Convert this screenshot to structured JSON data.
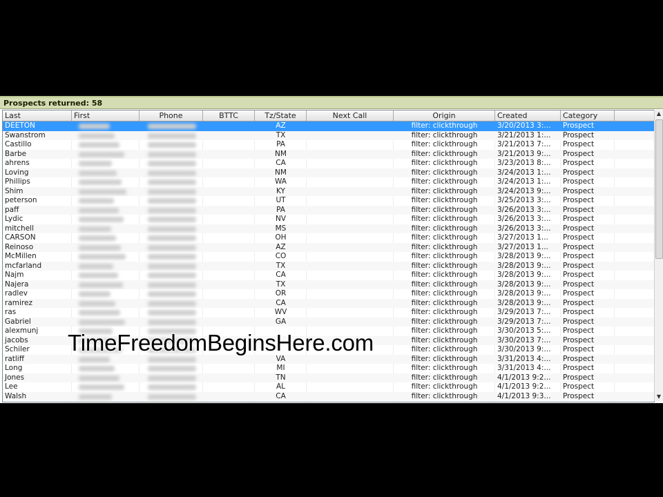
{
  "status": {
    "text": "Prospects returned: 58"
  },
  "columns": [
    "Last",
    "First",
    "Phone",
    "BTTC",
    "Tz/State",
    "Next Call",
    "Origin",
    "Created",
    "Category"
  ],
  "rows": [
    {
      "last": "DEETON",
      "first": "",
      "phone": "",
      "bttc": "",
      "state": "AZ",
      "next_call": "",
      "origin": "filter: clickthrough",
      "created": "3/20/2013 3:...",
      "category": "Prospect"
    },
    {
      "last": "Swanstrom",
      "first": "",
      "phone": "",
      "bttc": "",
      "state": "TX",
      "next_call": "",
      "origin": "filter: clickthrough",
      "created": "3/21/2013 1:...",
      "category": "Prospect"
    },
    {
      "last": "Castillo",
      "first": "",
      "phone": "",
      "bttc": "",
      "state": "PA",
      "next_call": "",
      "origin": "filter: clickthrough",
      "created": "3/21/2013 7:...",
      "category": "Prospect"
    },
    {
      "last": "Barbe",
      "first": "",
      "phone": "",
      "bttc": "",
      "state": "NM",
      "next_call": "",
      "origin": "filter: clickthrough",
      "created": "3/21/2013 9:...",
      "category": "Prospect"
    },
    {
      "last": "ahrens",
      "first": "",
      "phone": "",
      "bttc": "",
      "state": "CA",
      "next_call": "",
      "origin": "filter: clickthrough",
      "created": "3/23/2013 8:...",
      "category": "Prospect"
    },
    {
      "last": "Loving",
      "first": "",
      "phone": "",
      "bttc": "",
      "state": "NM",
      "next_call": "",
      "origin": "filter: clickthrough",
      "created": "3/24/2013 1:...",
      "category": "Prospect"
    },
    {
      "last": "Phillips",
      "first": "",
      "phone": "",
      "bttc": "",
      "state": "WA",
      "next_call": "",
      "origin": "filter: clickthrough",
      "created": "3/24/2013 1:...",
      "category": "Prospect"
    },
    {
      "last": "Shim",
      "first": "",
      "phone": "",
      "bttc": "",
      "state": "KY",
      "next_call": "",
      "origin": "filter: clickthrough",
      "created": "3/24/2013 9:...",
      "category": "Prospect"
    },
    {
      "last": "peterson",
      "first": "",
      "phone": "",
      "bttc": "",
      "state": "UT",
      "next_call": "",
      "origin": "filter: clickthrough",
      "created": "3/25/2013 3:...",
      "category": "Prospect"
    },
    {
      "last": "paff",
      "first": "",
      "phone": "",
      "bttc": "",
      "state": "PA",
      "next_call": "",
      "origin": "filter: clickthrough",
      "created": "3/26/2013 3:...",
      "category": "Prospect"
    },
    {
      "last": "Lydic",
      "first": "",
      "phone": "",
      "bttc": "",
      "state": "NV",
      "next_call": "",
      "origin": "filter: clickthrough",
      "created": "3/26/2013 3:...",
      "category": "Prospect"
    },
    {
      "last": "mitchell",
      "first": "",
      "phone": "",
      "bttc": "",
      "state": "MS",
      "next_call": "",
      "origin": "filter: clickthrough",
      "created": "3/26/2013 3:...",
      "category": "Prospect"
    },
    {
      "last": "CARSON",
      "first": "",
      "phone": "",
      "bttc": "",
      "state": "OH",
      "next_call": "",
      "origin": "filter: clickthrough",
      "created": "3/27/2013 1...",
      "category": "Prospect"
    },
    {
      "last": "Reinoso",
      "first": "",
      "phone": "",
      "bttc": "",
      "state": "AZ",
      "next_call": "",
      "origin": "filter: clickthrough",
      "created": "3/27/2013 1...",
      "category": "Prospect"
    },
    {
      "last": "McMillen",
      "first": "",
      "phone": "",
      "bttc": "",
      "state": "CO",
      "next_call": "",
      "origin": "filter: clickthrough",
      "created": "3/28/2013 9:...",
      "category": "Prospect"
    },
    {
      "last": "mcfarland",
      "first": "",
      "phone": "",
      "bttc": "",
      "state": "TX",
      "next_call": "",
      "origin": "filter: clickthrough",
      "created": "3/28/2013 9:...",
      "category": "Prospect"
    },
    {
      "last": "Najm",
      "first": "",
      "phone": "",
      "bttc": "",
      "state": "CA",
      "next_call": "",
      "origin": "filter: clickthrough",
      "created": "3/28/2013 9:...",
      "category": "Prospect"
    },
    {
      "last": "Najera",
      "first": "",
      "phone": "",
      "bttc": "",
      "state": "TX",
      "next_call": "",
      "origin": "filter: clickthrough",
      "created": "3/28/2013 9:...",
      "category": "Prospect"
    },
    {
      "last": "radlev",
      "first": "",
      "phone": "",
      "bttc": "",
      "state": "OR",
      "next_call": "",
      "origin": "filter: clickthrough",
      "created": "3/28/2013 9:...",
      "category": "Prospect"
    },
    {
      "last": "ramirez",
      "first": "",
      "phone": "",
      "bttc": "",
      "state": "CA",
      "next_call": "",
      "origin": "filter: clickthrough",
      "created": "3/28/2013 9:...",
      "category": "Prospect"
    },
    {
      "last": "ras",
      "first": "",
      "phone": "",
      "bttc": "",
      "state": "WV",
      "next_call": "",
      "origin": "filter: clickthrough",
      "created": "3/29/2013 7:...",
      "category": "Prospect"
    },
    {
      "last": "Gabriel",
      "first": "",
      "phone": "",
      "bttc": "",
      "state": "GA",
      "next_call": "",
      "origin": "filter: clickthrough",
      "created": "3/29/2013 7:...",
      "category": "Prospect"
    },
    {
      "last": "alexmunj",
      "first": "",
      "phone": "",
      "bttc": "",
      "state": "",
      "next_call": "",
      "origin": "filter: clickthrough",
      "created": "3/30/2013 5:...",
      "category": "Prospect"
    },
    {
      "last": "jacobs",
      "first": "",
      "phone": "",
      "bttc": "",
      "state": "",
      "next_call": "",
      "origin": "filter: clickthrough",
      "created": "3/30/2013 7:...",
      "category": "Prospect"
    },
    {
      "last": "Schiler",
      "first": "",
      "phone": "",
      "bttc": "",
      "state": "",
      "next_call": "",
      "origin": "filter: clickthrough",
      "created": "3/30/2013 9:...",
      "category": "Prospect"
    },
    {
      "last": "ratliff",
      "first": "",
      "phone": "",
      "bttc": "",
      "state": "VA",
      "next_call": "",
      "origin": "filter: clickthrough",
      "created": "3/31/2013 4:...",
      "category": "Prospect"
    },
    {
      "last": "Long",
      "first": "",
      "phone": "",
      "bttc": "",
      "state": "MI",
      "next_call": "",
      "origin": "filter: clickthrough",
      "created": "3/31/2013 4:...",
      "category": "Prospect"
    },
    {
      "last": "Jones",
      "first": "",
      "phone": "",
      "bttc": "",
      "state": "TN",
      "next_call": "",
      "origin": "filter: clickthrough",
      "created": "4/1/2013 9:2...",
      "category": "Prospect"
    },
    {
      "last": "Lee",
      "first": "",
      "phone": "",
      "bttc": "",
      "state": "AL",
      "next_call": "",
      "origin": "filter: clickthrough",
      "created": "4/1/2013 9:2...",
      "category": "Prospect"
    },
    {
      "last": "Walsh",
      "first": "",
      "phone": "",
      "bttc": "",
      "state": "CA",
      "next_call": "",
      "origin": "filter: clickthrough",
      "created": "4/1/2013 9:3...",
      "category": "Prospect"
    }
  ],
  "selected_row": 0,
  "scrollbar": {
    "up_icon": "arrow-up-icon",
    "down_icon": "arrow-down-icon"
  },
  "watermark": {
    "text": "TimeFreedomBeginsHere.com"
  },
  "colors": {
    "status_bg": "#d3dcb2",
    "selection": "#3399ff",
    "backdrop": "#000000"
  }
}
